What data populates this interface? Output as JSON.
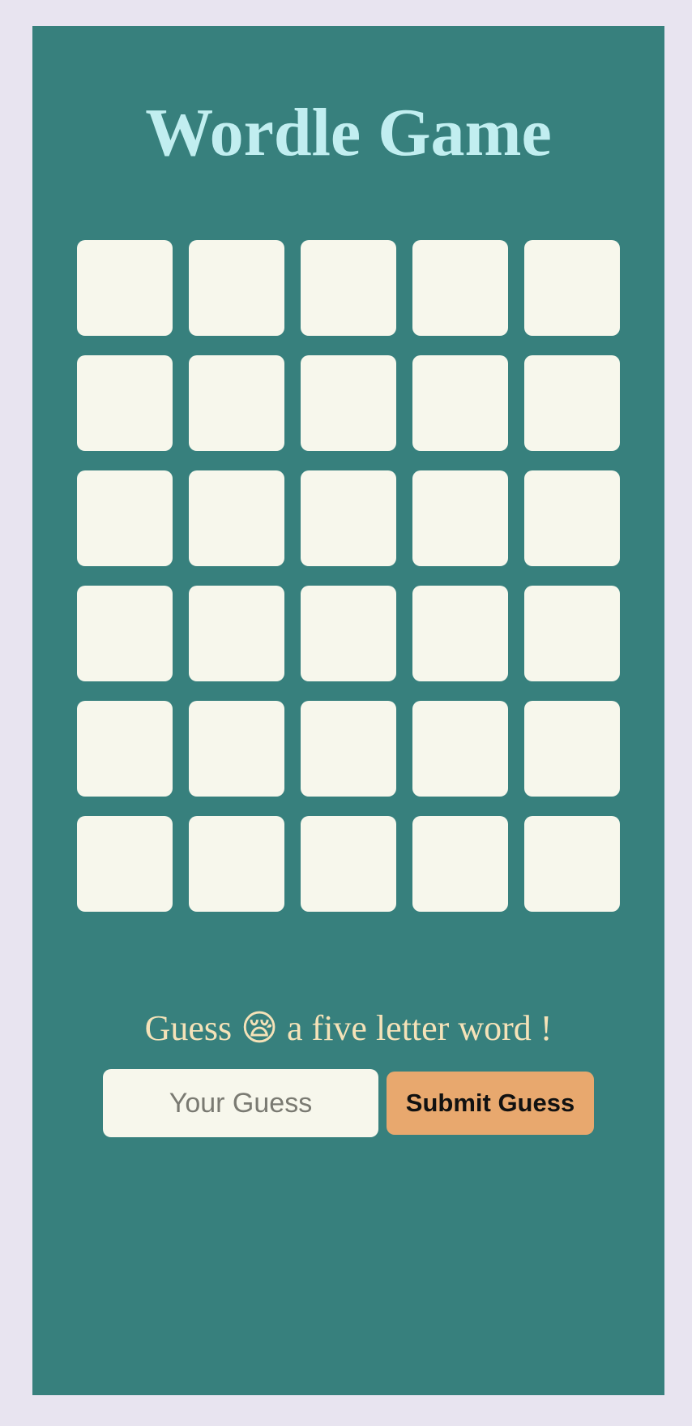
{
  "title": "Wordle Game",
  "grid": {
    "rows": 6,
    "cols": 5,
    "letters": [
      [
        "",
        "",
        "",
        "",
        ""
      ],
      [
        "",
        "",
        "",
        "",
        ""
      ],
      [
        "",
        "",
        "",
        "",
        ""
      ],
      [
        "",
        "",
        "",
        "",
        ""
      ],
      [
        "",
        "",
        "",
        "",
        ""
      ],
      [
        "",
        "",
        "",
        "",
        ""
      ]
    ]
  },
  "prompt": {
    "before": "Guess ",
    "emoji": "😪",
    "after": " a five letter word !"
  },
  "guess": {
    "value": "",
    "placeholder": "Your Guess"
  },
  "submit_label": "Submit Guess",
  "colors": {
    "background": "#e8e4f0",
    "panel": "#37807d",
    "title": "#c1eef0",
    "tile": "#f7f7ec",
    "prompt": "#f5e2b8",
    "button": "#e8a86e"
  }
}
